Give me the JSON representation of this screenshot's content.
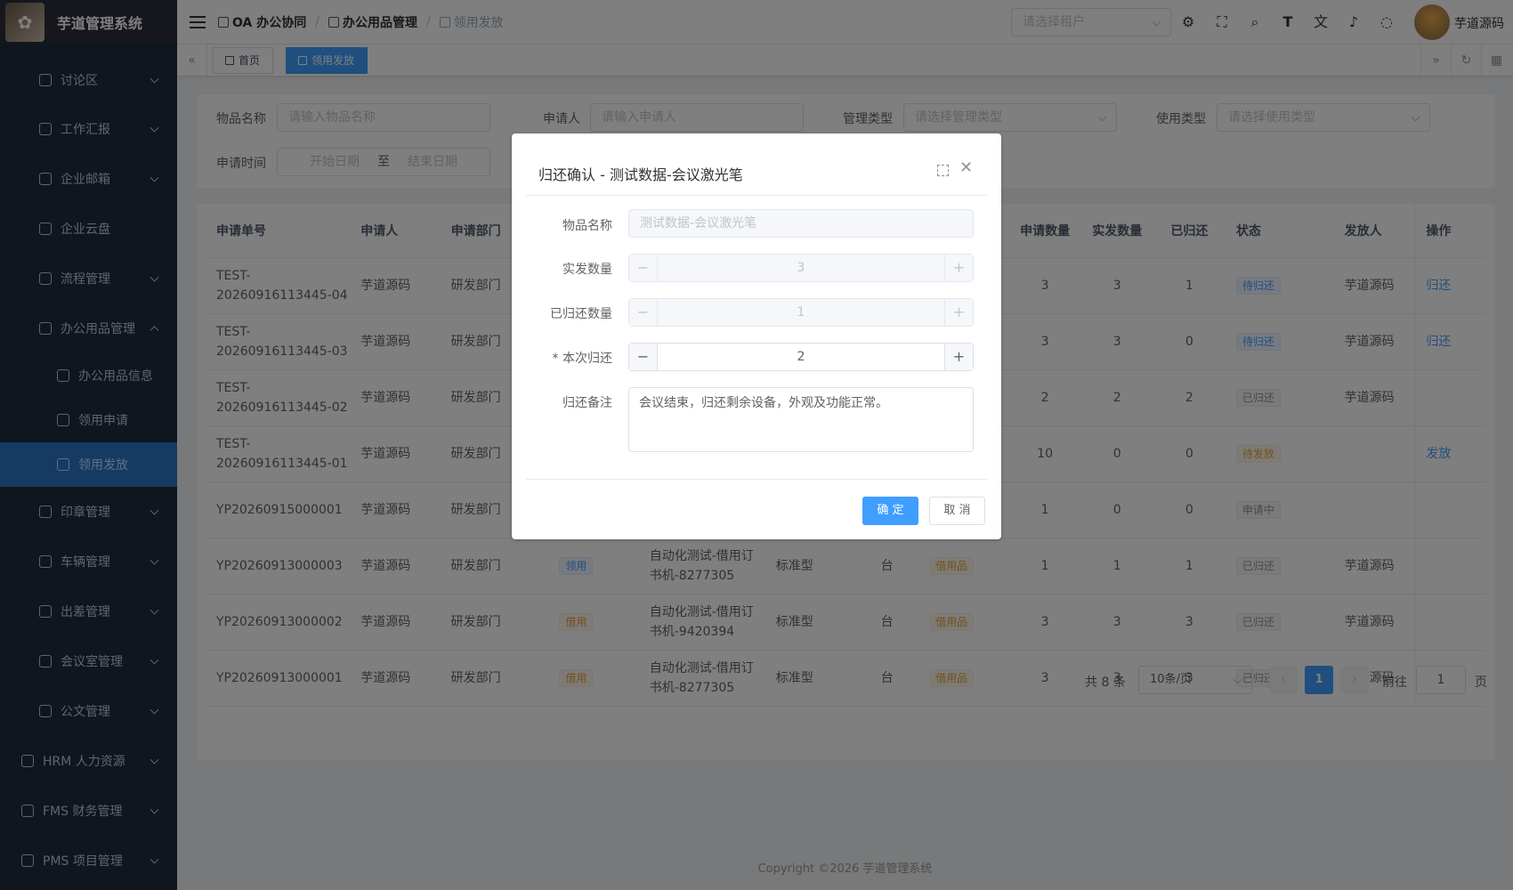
{
  "app": {
    "title": "芋道管理系统"
  },
  "sidebar": {
    "items": [
      {
        "label": "讨论区"
      },
      {
        "label": "工作汇报"
      },
      {
        "label": "企业邮箱"
      },
      {
        "label": "企业云盘"
      },
      {
        "label": "流程管理"
      },
      {
        "label": "办公用品管理"
      },
      {
        "label": "办公用品信息"
      },
      {
        "label": "领用申请"
      },
      {
        "label": "领用发放"
      },
      {
        "label": "印章管理"
      },
      {
        "label": "车辆管理"
      },
      {
        "label": "出差管理"
      },
      {
        "label": "会议室管理"
      },
      {
        "label": "公文管理"
      },
      {
        "label": "HRM 人力资源"
      },
      {
        "label": "FMS 财务管理"
      },
      {
        "label": "PMS 项目管理"
      }
    ]
  },
  "navbar": {
    "breadcrumb": [
      "OA 办公协同",
      "办公用品管理",
      "领用发放"
    ],
    "tenant_placeholder": "请选择租户",
    "username": "芋道源码"
  },
  "tags": {
    "home": "首页",
    "current": "领用发放"
  },
  "search": {
    "item_name_label": "物品名称",
    "item_name_ph": "请输入物品名称",
    "applicant_label": "申请人",
    "applicant_ph": "请输入申请人",
    "mgmt_type_label": "管理类型",
    "mgmt_type_ph": "请选择管理类型",
    "use_type_label": "使用类型",
    "use_type_ph": "请选择使用类型",
    "date_label": "申请时间",
    "date_start": "开始日期",
    "date_to": "至",
    "date_end": "结束日期"
  },
  "table": {
    "headers": {
      "no": "申请单号",
      "applicant": "申请人",
      "dept": "申请部门",
      "req": "申请数量",
      "issued": "实发数量",
      "returned": "已归还",
      "status": "状态",
      "issuer": "发放人",
      "op": "操作"
    },
    "rows": [
      {
        "no": "TEST-20260916113445-04",
        "applicant": "芋道源码",
        "dept": "研发部门",
        "type": "",
        "item": "",
        "spec": "",
        "unit": "",
        "use": "",
        "req": "3",
        "issued": "3",
        "returned": "1",
        "status": "待归还",
        "issuer": "芋道源码",
        "op": "归还"
      },
      {
        "no": "TEST-20260916113445-03",
        "applicant": "芋道源码",
        "dept": "研发部门",
        "type": "",
        "item": "",
        "spec": "",
        "unit": "",
        "use": "",
        "req": "3",
        "issued": "3",
        "returned": "0",
        "status": "待归还",
        "issuer": "芋道源码",
        "op": "归还"
      },
      {
        "no": "TEST-20260916113445-02",
        "applicant": "芋道源码",
        "dept": "研发部门",
        "type": "",
        "item": "",
        "spec": "",
        "unit": "",
        "use": "",
        "req": "2",
        "issued": "2",
        "returned": "2",
        "status": "已归还",
        "issuer": "芋道源码",
        "op": ""
      },
      {
        "no": "TEST-20260916113445-01",
        "applicant": "芋道源码",
        "dept": "研发部门",
        "type": "",
        "item": "",
        "spec": "",
        "unit": "",
        "use": "",
        "req": "10",
        "issued": "0",
        "returned": "0",
        "status": "待发放",
        "issuer": "",
        "op": "发放"
      },
      {
        "no": "YP20260915000001",
        "applicant": "芋道源码",
        "dept": "研发部门",
        "type": "",
        "item": "",
        "spec": "",
        "unit": "",
        "use": "",
        "req": "1",
        "issued": "0",
        "returned": "0",
        "status": "申请中",
        "issuer": "",
        "op": ""
      },
      {
        "no": "YP20260913000003",
        "applicant": "芋道源码",
        "dept": "研发部门",
        "type": "领用",
        "item": "自动化测试-借用订书机-8277305",
        "spec": "标准型",
        "unit": "台",
        "use": "借用品",
        "req": "1",
        "issued": "1",
        "returned": "1",
        "status": "已归还",
        "issuer": "芋道源码",
        "op": ""
      },
      {
        "no": "YP20260913000002",
        "applicant": "芋道源码",
        "dept": "研发部门",
        "type": "借用",
        "item": "自动化测试-借用订书机-9420394",
        "spec": "标准型",
        "unit": "台",
        "use": "借用品",
        "req": "3",
        "issued": "3",
        "returned": "3",
        "status": "已归还",
        "issuer": "芋道源码",
        "op": ""
      },
      {
        "no": "YP20260913000001",
        "applicant": "芋道源码",
        "dept": "研发部门",
        "type": "借用",
        "item": "自动化测试-借用订书机-8277305",
        "spec": "标准型",
        "unit": "台",
        "use": "借用品",
        "req": "3",
        "issued": "3",
        "returned": "3",
        "status": "已归还",
        "issuer": "芋道源码",
        "op": ""
      }
    ]
  },
  "pager": {
    "total": "共 8 条",
    "size": "10条/页",
    "page": "1",
    "goto": "前往",
    "goto_val": "1",
    "page_suffix": "页"
  },
  "copyright": "Copyright ©2026 芋道管理系统",
  "dialog": {
    "title": "归还确认 - 测试数据-会议激光笔",
    "item_label": "物品名称",
    "item_value": "测试数据-会议激光笔",
    "issued_label": "实发数量",
    "issued_value": "3",
    "returned_label": "已归还数量",
    "returned_value": "1",
    "this_label": "* 本次归还",
    "this_value": "2",
    "remark_label": "归还备注",
    "remark_value": "会议结束，归还剩余设备，外观及功能正常。",
    "ok": "确 定",
    "cancel": "取 消"
  }
}
